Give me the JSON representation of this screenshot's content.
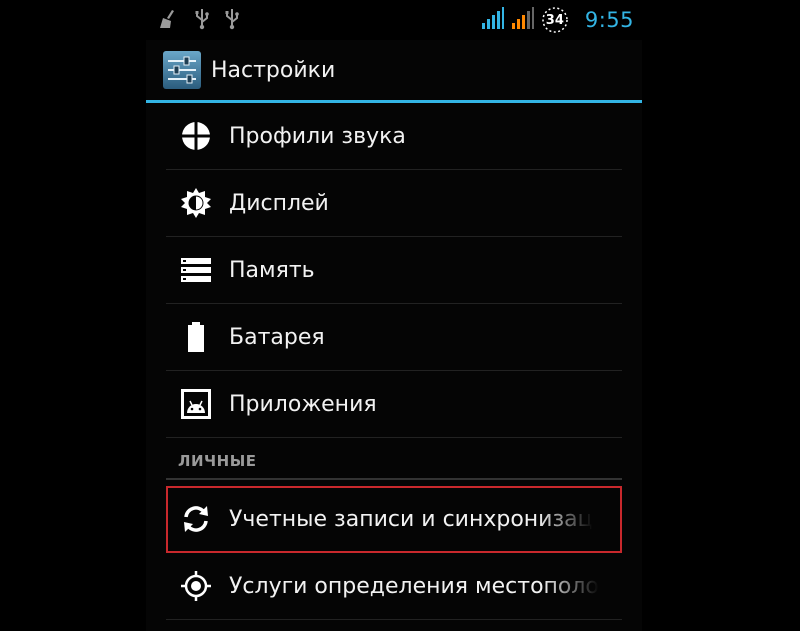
{
  "status_bar": {
    "icons": [
      "broom-icon",
      "usb-icon",
      "usb-icon"
    ],
    "battery_level": "34",
    "time": "9:55",
    "signal_icons": [
      "signal-blue-icon",
      "signal-orange-icon"
    ]
  },
  "action_bar": {
    "title": "Настройки",
    "icon": "settings-sliders-icon"
  },
  "colors": {
    "accent": "#33b5e5",
    "highlight_border": "#c8282c",
    "text": "#f2f2f2",
    "section_text": "#9a9a9a"
  },
  "items": [
    {
      "label": "Профили звука",
      "icon": "sound-profile-icon"
    },
    {
      "label": "Дисплей",
      "icon": "display-brightness-icon"
    },
    {
      "label": "Память",
      "icon": "storage-icon"
    },
    {
      "label": "Батарея",
      "icon": "battery-icon"
    },
    {
      "label": "Приложения",
      "icon": "apps-icon"
    }
  ],
  "personal_section": {
    "header": "ЛИЧНЫЕ",
    "items": [
      {
        "label": "Учетные записи и синхронизац",
        "icon": "sync-icon"
      },
      {
        "label": "Услуги определения местополо",
        "icon": "location-icon"
      }
    ]
  }
}
